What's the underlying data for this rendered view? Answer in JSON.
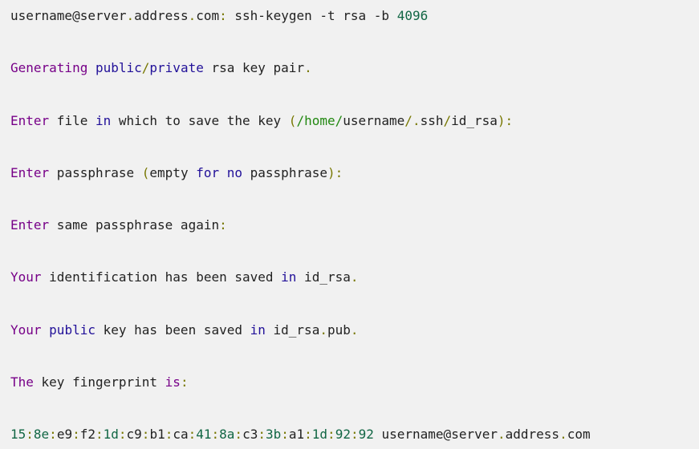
{
  "colors": {
    "plain": "#222222",
    "keyword": "#770088",
    "builtin": "#221199",
    "punct": "#777700",
    "number": "#116644",
    "path": "#228811"
  },
  "lines": [
    {
      "name": "command-line",
      "tokens": [
        {
          "t": "username@server",
          "c": "plain"
        },
        {
          "t": ".",
          "c": "punct"
        },
        {
          "t": "address",
          "c": "plain"
        },
        {
          "t": ".",
          "c": "punct"
        },
        {
          "t": "com",
          "c": "plain"
        },
        {
          "t": ":",
          "c": "punct"
        },
        {
          "t": " ssh-keygen -t rsa -b ",
          "c": "plain"
        },
        {
          "t": "4096",
          "c": "number"
        }
      ]
    },
    {
      "name": "output-generating",
      "tokens": [
        {
          "t": "Generating",
          "c": "keyword"
        },
        {
          "t": " ",
          "c": "plain"
        },
        {
          "t": "public",
          "c": "builtin"
        },
        {
          "t": "/",
          "c": "punct"
        },
        {
          "t": "private",
          "c": "builtin"
        },
        {
          "t": " rsa key pair",
          "c": "plain"
        },
        {
          "t": ".",
          "c": "punct"
        }
      ]
    },
    {
      "name": "prompt-enter-file",
      "tokens": [
        {
          "t": "Enter",
          "c": "keyword"
        },
        {
          "t": " file ",
          "c": "plain"
        },
        {
          "t": "in",
          "c": "builtin"
        },
        {
          "t": " which to save the key ",
          "c": "plain"
        },
        {
          "t": "(",
          "c": "punct"
        },
        {
          "t": "/home/",
          "c": "path"
        },
        {
          "t": "username",
          "c": "plain"
        },
        {
          "t": "/",
          "c": "punct"
        },
        {
          "t": ".",
          "c": "punct"
        },
        {
          "t": "ssh",
          "c": "plain"
        },
        {
          "t": "/",
          "c": "punct"
        },
        {
          "t": "id_rsa",
          "c": "plain"
        },
        {
          "t": "):",
          "c": "punct"
        }
      ]
    },
    {
      "name": "prompt-enter-passphrase",
      "tokens": [
        {
          "t": "Enter",
          "c": "keyword"
        },
        {
          "t": " passphrase ",
          "c": "plain"
        },
        {
          "t": "(",
          "c": "punct"
        },
        {
          "t": "empty ",
          "c": "plain"
        },
        {
          "t": "for",
          "c": "builtin"
        },
        {
          "t": " ",
          "c": "plain"
        },
        {
          "t": "no",
          "c": "builtin"
        },
        {
          "t": " passphrase",
          "c": "plain"
        },
        {
          "t": "):",
          "c": "punct"
        }
      ]
    },
    {
      "name": "prompt-enter-passphrase-again",
      "tokens": [
        {
          "t": "Enter",
          "c": "keyword"
        },
        {
          "t": " same passphrase again",
          "c": "plain"
        },
        {
          "t": ":",
          "c": "punct"
        }
      ]
    },
    {
      "name": "output-identification-saved",
      "tokens": [
        {
          "t": "Your",
          "c": "keyword"
        },
        {
          "t": " identification has been saved ",
          "c": "plain"
        },
        {
          "t": "in",
          "c": "builtin"
        },
        {
          "t": " id_rsa",
          "c": "plain"
        },
        {
          "t": ".",
          "c": "punct"
        }
      ]
    },
    {
      "name": "output-public-key-saved",
      "tokens": [
        {
          "t": "Your",
          "c": "keyword"
        },
        {
          "t": " ",
          "c": "plain"
        },
        {
          "t": "public",
          "c": "builtin"
        },
        {
          "t": " key has been saved ",
          "c": "plain"
        },
        {
          "t": "in",
          "c": "builtin"
        },
        {
          "t": " id_rsa",
          "c": "plain"
        },
        {
          "t": ".",
          "c": "punct"
        },
        {
          "t": "pub",
          "c": "plain"
        },
        {
          "t": ".",
          "c": "punct"
        }
      ]
    },
    {
      "name": "output-fingerprint-header",
      "tokens": [
        {
          "t": "The",
          "c": "keyword"
        },
        {
          "t": " key fingerprint ",
          "c": "plain"
        },
        {
          "t": "is",
          "c": "keyword"
        },
        {
          "t": ":",
          "c": "punct"
        }
      ]
    },
    {
      "name": "output-fingerprint-value",
      "tokens": [
        {
          "t": "15",
          "c": "number"
        },
        {
          "t": ":",
          "c": "punct"
        },
        {
          "t": "8e",
          "c": "number"
        },
        {
          "t": ":",
          "c": "punct"
        },
        {
          "t": "e9",
          "c": "plain"
        },
        {
          "t": ":",
          "c": "punct"
        },
        {
          "t": "f2",
          "c": "plain"
        },
        {
          "t": ":",
          "c": "punct"
        },
        {
          "t": "1d",
          "c": "number"
        },
        {
          "t": ":",
          "c": "punct"
        },
        {
          "t": "c9",
          "c": "plain"
        },
        {
          "t": ":",
          "c": "punct"
        },
        {
          "t": "b1",
          "c": "plain"
        },
        {
          "t": ":",
          "c": "punct"
        },
        {
          "t": "ca",
          "c": "plain"
        },
        {
          "t": ":",
          "c": "punct"
        },
        {
          "t": "41",
          "c": "number"
        },
        {
          "t": ":",
          "c": "punct"
        },
        {
          "t": "8a",
          "c": "number"
        },
        {
          "t": ":",
          "c": "punct"
        },
        {
          "t": "c3",
          "c": "plain"
        },
        {
          "t": ":",
          "c": "punct"
        },
        {
          "t": "3b",
          "c": "number"
        },
        {
          "t": ":",
          "c": "punct"
        },
        {
          "t": "a1",
          "c": "plain"
        },
        {
          "t": ":",
          "c": "punct"
        },
        {
          "t": "1d",
          "c": "number"
        },
        {
          "t": ":",
          "c": "punct"
        },
        {
          "t": "92",
          "c": "number"
        },
        {
          "t": ":",
          "c": "punct"
        },
        {
          "t": "92",
          "c": "number"
        },
        {
          "t": " username@server",
          "c": "plain"
        },
        {
          "t": ".",
          "c": "punct"
        },
        {
          "t": "address",
          "c": "plain"
        },
        {
          "t": ".",
          "c": "punct"
        },
        {
          "t": "com",
          "c": "plain"
        }
      ]
    }
  ]
}
